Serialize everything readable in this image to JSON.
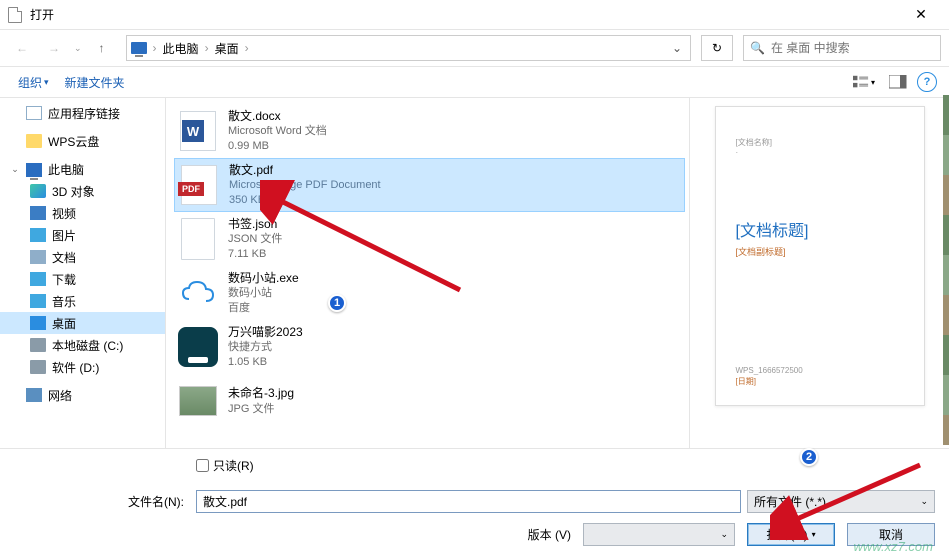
{
  "titlebar": {
    "title": "打开"
  },
  "nav": {
    "crumbs": [
      "此电脑",
      "桌面"
    ],
    "search_placeholder": "在 桌面 中搜索"
  },
  "toolbar": {
    "organize": "组织",
    "new_folder": "新建文件夹"
  },
  "sidebar": {
    "app_links": "应用程序链接",
    "wps": "WPS云盘",
    "this_pc": "此电脑",
    "obj3d": "3D 对象",
    "video": "视频",
    "pictures": "图片",
    "documents": "文档",
    "downloads": "下载",
    "music": "音乐",
    "desktop": "桌面",
    "localc": "本地磁盘 (C:)",
    "softd": "软件 (D:)",
    "network": "网络"
  },
  "files": [
    {
      "name": "散文.docx",
      "type": "Microsoft Word 文档",
      "size": "0.99 MB"
    },
    {
      "name": "散文.pdf",
      "type": "Microsoft Edge PDF Document",
      "size": "350 KB"
    },
    {
      "name": "书签.json",
      "type": "JSON 文件",
      "size": "7.11 KB"
    },
    {
      "name": "数码小站.exe",
      "type": "数码小站",
      "size": "百度"
    },
    {
      "name": "万兴喵影2023",
      "type": "快捷方式",
      "size": "1.05 KB"
    },
    {
      "name": "未命名-3.jpg",
      "type": "JPG 文件",
      "size": ""
    }
  ],
  "preview": {
    "tiny": "[文档名称]",
    "title": "[文档标题]",
    "sub": "[文档副标题]",
    "foot1": "WPS_1666572500",
    "foot2": "[日期]"
  },
  "footer": {
    "readonly": "只读(R)",
    "filename_label": "文件名(N):",
    "filename_value": "散文.pdf",
    "filter_label": "所有文件 (*.*)",
    "version_label": "版本 (V)",
    "open": "打开(O)",
    "cancel": "取消"
  },
  "annotations": {
    "b1": "1",
    "b2": "2"
  },
  "watermark": "www.xz7.com"
}
